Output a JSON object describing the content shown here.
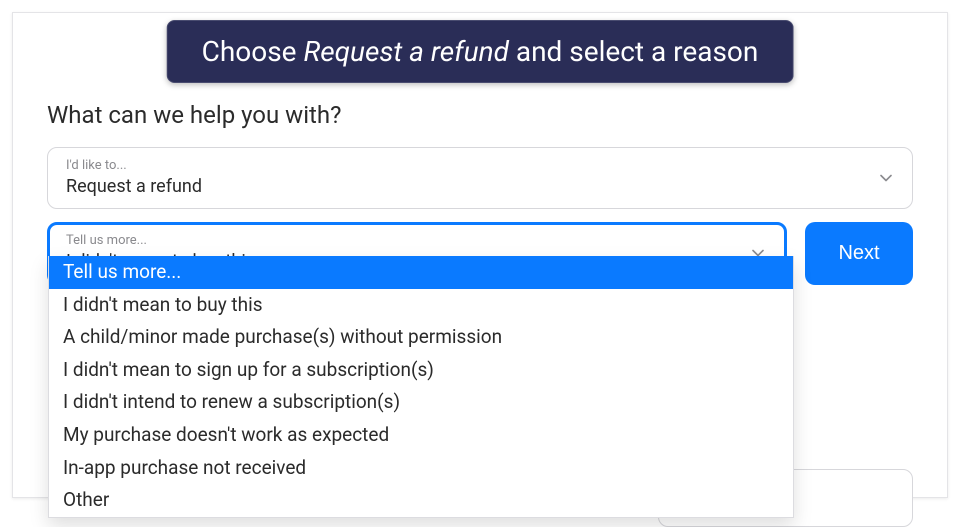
{
  "caption": {
    "prefix": "Choose ",
    "italic": "Request a refund",
    "suffix": " and select a reason"
  },
  "heading": "What can we help you with?",
  "select1": {
    "label": "I'd like to...",
    "value": "Request a refund"
  },
  "select2": {
    "label": "Tell us more...",
    "value": "I didn't mean to buy this"
  },
  "next_label": "Next",
  "dropdown": {
    "placeholder": "Tell us more...",
    "options": [
      "I didn't mean to buy this",
      "A child/minor made purchase(s) without permission",
      "I didn't mean to sign up for a subscription(s)",
      "I didn't intend to renew a subscription(s)",
      "My purchase doesn't work as expected",
      "In-app purchase not received",
      "Other"
    ]
  }
}
